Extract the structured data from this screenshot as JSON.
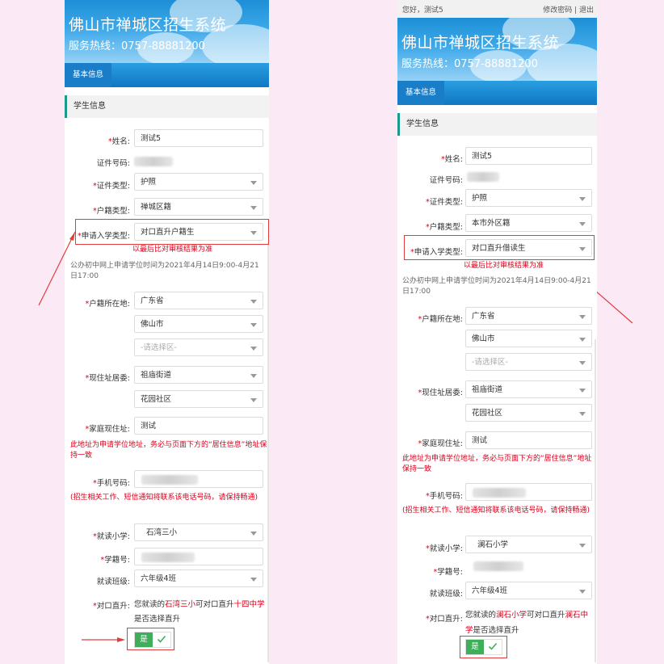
{
  "left_screen": {
    "banner": {
      "title": "佛山市禅城区招生系统",
      "hotline": "服务热线：0757-88881200"
    },
    "nav": {
      "tab_basic": "基本信息"
    },
    "section_title": "学生信息",
    "fields": {
      "name": {
        "label": "姓名:",
        "value": "测试5"
      },
      "id_number": {
        "label": "证件号码:"
      },
      "id_type": {
        "label": "证件类型:",
        "value": "护照"
      },
      "hukou_type": {
        "label": "户籍类型:",
        "value": "禅城区籍"
      },
      "enroll_type": {
        "label": "申请入学类型:",
        "value": "对口直升户籍生"
      },
      "hukou_location": {
        "label": "户籍所在地:",
        "province": "广东省",
        "city": "佛山市",
        "district_placeholder": "-请选择区-"
      },
      "current_address": {
        "label": "现住址居委:",
        "street": "祖庙街道",
        "community": "花园社区"
      },
      "home_address": {
        "label": "家庭现住址:",
        "value": "测试"
      },
      "phone": {
        "label": "手机号码:"
      },
      "primary_school": {
        "label": "就读小学:",
        "value": "石湾三小"
      },
      "student_number": {
        "label": "学籍号:"
      },
      "class": {
        "label": "就读班级:",
        "value": "六年级4班"
      },
      "direct_promotion": {
        "label": "对口直升:"
      }
    },
    "notes": {
      "verify": "以最后比对审核结果为准",
      "time": "公办初中网上申请学位时间为2021年4月14日9:00-4月21日17:00",
      "address_warning": "此地址为申请学位地址，务必与页面下方的“居住信息”地址保持一致",
      "phone_warning": "(招生相关工作、短信通知将联系该电话号码，请保持畅通)",
      "promo_prefix": "您就读的",
      "promo_school": "石湾三小",
      "promo_mid": "可对口直升",
      "promo_target": "十四中学",
      "promo_suffix": "是否选择直升"
    },
    "toggle": {
      "label": "是"
    }
  },
  "right_screen": {
    "topbar": {
      "greeting": "您好，测试5",
      "links": "修改密码 | 退出"
    },
    "banner": {
      "title": "佛山市禅城区招生系统",
      "hotline": "服务热线：0757-88881200"
    },
    "nav": {
      "tab_basic": "基本信息"
    },
    "section_title": "学生信息",
    "fields": {
      "name": {
        "label": "姓名:",
        "value": "测试5"
      },
      "id_number": {
        "label": "证件号码:"
      },
      "id_type": {
        "label": "证件类型:",
        "value": "护照"
      },
      "hukou_type": {
        "label": "户籍类型:",
        "value": "本市外区籍"
      },
      "enroll_type": {
        "label": "申请入学类型:",
        "value": "对口直升借读生"
      },
      "hukou_location": {
        "label": "户籍所在地:",
        "province": "广东省",
        "city": "佛山市",
        "district_placeholder": "-请选择区-"
      },
      "current_address": {
        "label": "现住址居委:",
        "street": "祖庙街道",
        "community": "花园社区"
      },
      "home_address": {
        "label": "家庭现住址:",
        "value": "测试"
      },
      "phone": {
        "label": "手机号码:"
      },
      "primary_school": {
        "label": "就读小学:",
        "value": "澜石小学"
      },
      "student_number": {
        "label": "学籍号:"
      },
      "class": {
        "label": "就读班级:",
        "value": "六年级4班"
      },
      "direct_promotion": {
        "label": "对口直升:"
      }
    },
    "notes": {
      "verify": "以最后比对审核结果为准",
      "time": "公办初中网上申请学位时间为2021年4月14日9:00-4月21日17:00",
      "address_warning": "此地址为申请学位地址，务必与页面下方的“居住信息”地址保持一致",
      "phone_warning": "(招生相关工作、短信通知将联系该电话号码，请保持畅通)",
      "promo_prefix": "您就读的",
      "promo_school": "澜石小学",
      "promo_mid": "可对口直升",
      "promo_target": "澜石中学",
      "promo_suffix": "是否选择直升"
    },
    "toggle": {
      "label": "是"
    }
  },
  "colors": {
    "background": "#fbeaf6",
    "banner": "#1d8fd6",
    "required": "#d9001b",
    "toggle_on": "#3fae5b",
    "annotation": "#e23d3d"
  }
}
